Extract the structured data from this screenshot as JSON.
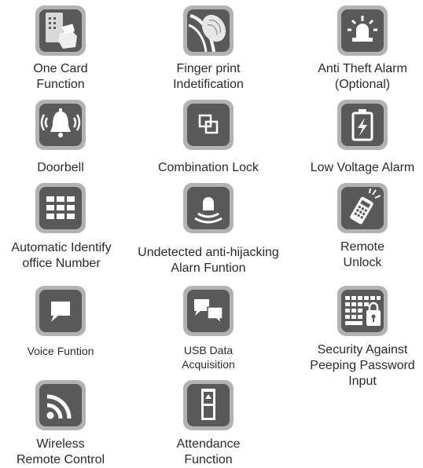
{
  "colors": {
    "tile_border": "#b2b2b2",
    "tile_fill": "#595959",
    "icon": "#ffffff",
    "text": "#2a2a2a"
  },
  "features": [
    {
      "icon": "card-swipe-icon",
      "line1": "One Card",
      "line2": "Function"
    },
    {
      "icon": "fingerprint-icon",
      "line1": "Finger print",
      "line2": "Indetification"
    },
    {
      "icon": "alarm-siren-icon",
      "line1": "Anti Theft Alarm",
      "line2": "(Optional)"
    },
    {
      "icon": "doorbell-icon",
      "line1": "Doorbell"
    },
    {
      "icon": "combination-lock-icon",
      "line1": "Combination Lock"
    },
    {
      "icon": "low-battery-icon",
      "line1": "Low Voltage Alarm"
    },
    {
      "icon": "keypad-icon",
      "line1": "Automatic Identify",
      "line2": "office Number"
    },
    {
      "icon": "anti-hijack-alarm-icon",
      "line1": "Undetected anti-hijacking",
      "line2": "Alarn Funtion"
    },
    {
      "icon": "remote-control-icon",
      "line1": "Remote",
      "line2": "Unlock"
    },
    {
      "icon": "speech-bubble-icon",
      "line1": "Voice Funtion"
    },
    {
      "icon": "usb-data-icon",
      "line1": "USB Data",
      "line2": "Acquisition"
    },
    {
      "icon": "keyboard-lock-icon",
      "line1": "Security Against",
      "line2": "Peeping Password",
      "line3": "Input"
    },
    {
      "icon": "wireless-signal-icon",
      "line1": "Wireless",
      "line2": "Remote Control"
    },
    {
      "icon": "attendance-icon",
      "line1": "Attendance",
      "line2": "Function"
    }
  ]
}
